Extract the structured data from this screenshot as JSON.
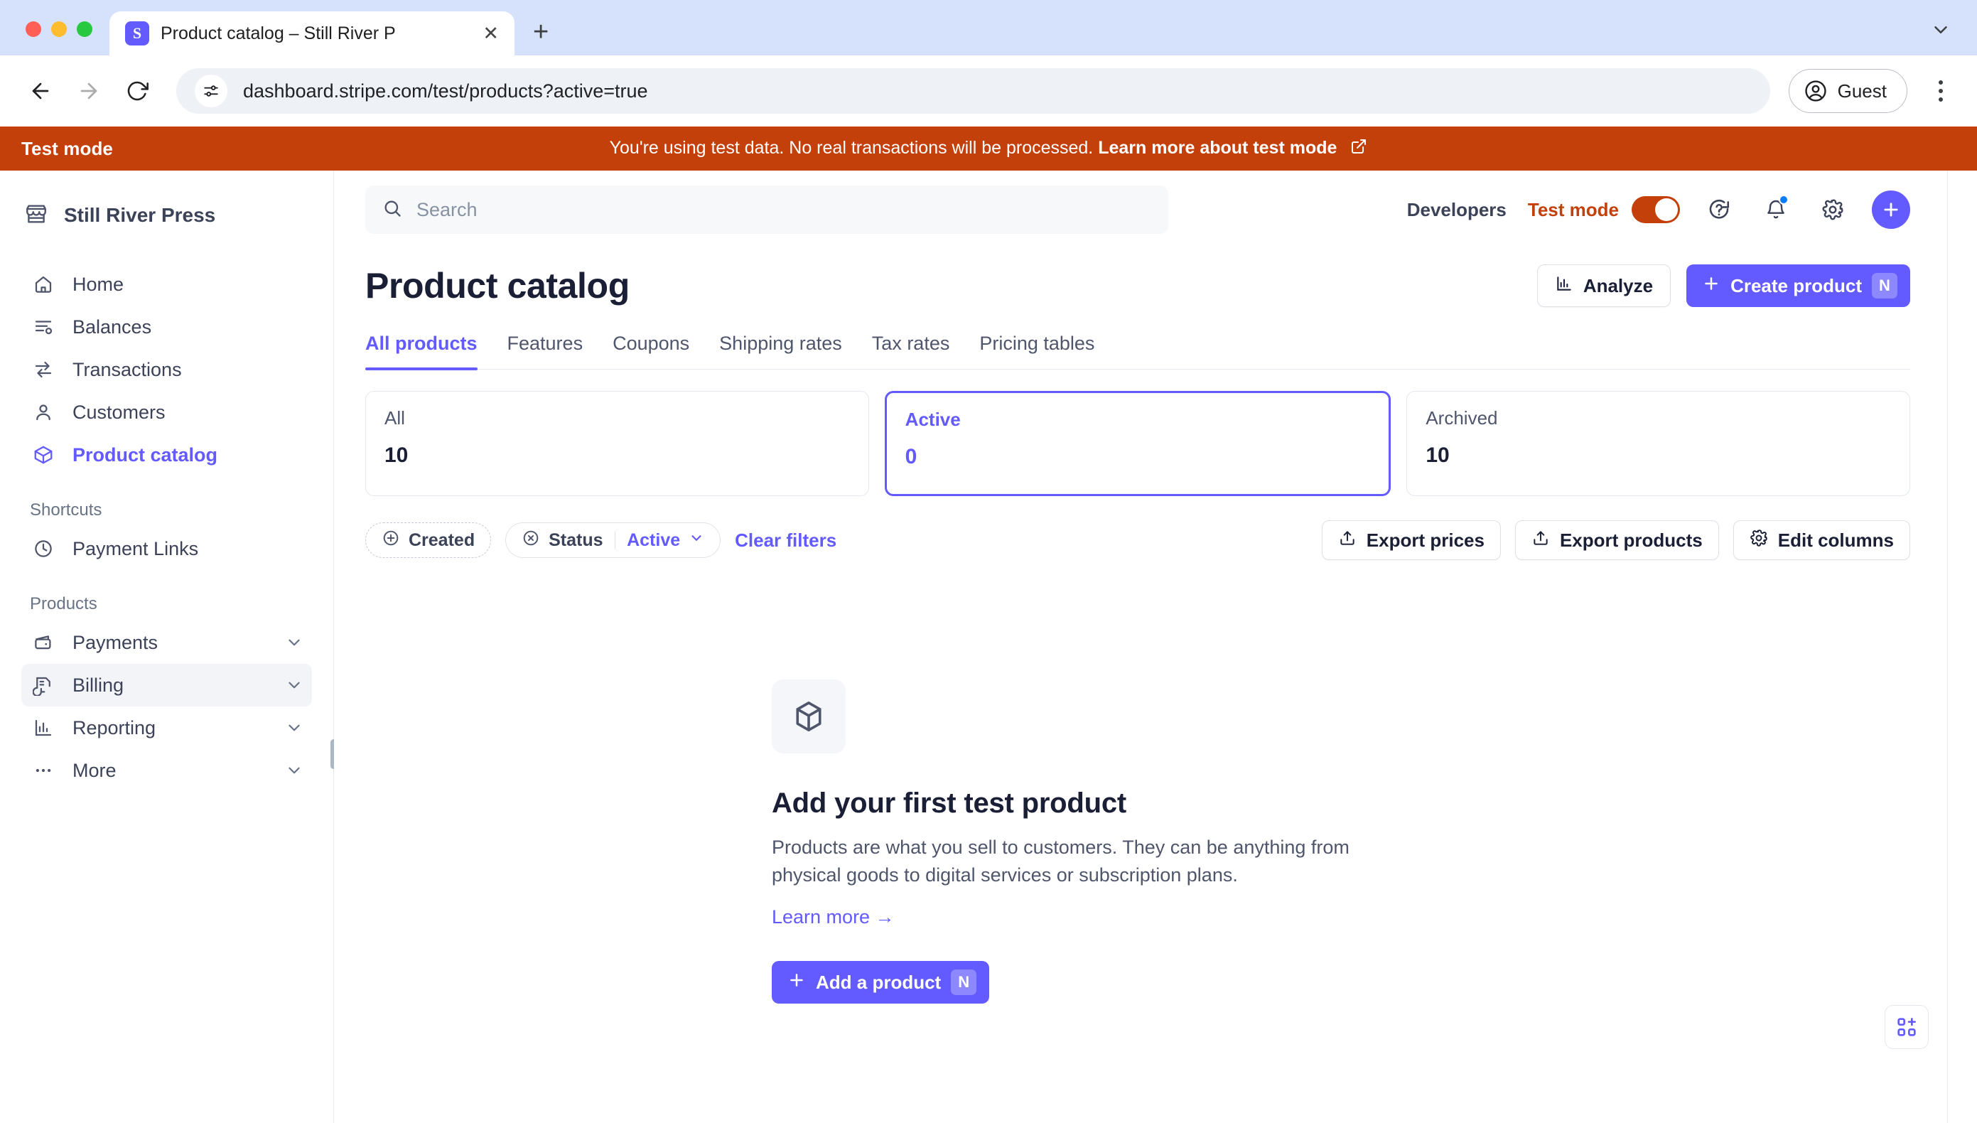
{
  "browser": {
    "tab_title": "Product catalog – Still River P",
    "favicon_letter": "S",
    "url": "dashboard.stripe.com/test/products?active=true",
    "profile_label": "Guest",
    "new_tab_label": "+",
    "close_tab_label": "✕"
  },
  "test_banner": {
    "left_label": "Test mode",
    "message": "You're using test data. No real transactions will be processed.",
    "link": "Learn more about test mode"
  },
  "sidebar": {
    "brand": "Still River Press",
    "items": [
      {
        "label": "Home",
        "icon": "home-icon",
        "active": false
      },
      {
        "label": "Balances",
        "icon": "balances-icon",
        "active": false
      },
      {
        "label": "Transactions",
        "icon": "transactions-icon",
        "active": false
      },
      {
        "label": "Customers",
        "icon": "customers-icon",
        "active": false
      },
      {
        "label": "Product catalog",
        "icon": "product-catalog-icon",
        "active": true
      }
    ],
    "shortcuts_label": "Shortcuts",
    "shortcuts": [
      {
        "label": "Payment Links",
        "icon": "clock-icon"
      }
    ],
    "products_label": "Products",
    "products": [
      {
        "label": "Payments",
        "icon": "wallet-icon",
        "hover": false
      },
      {
        "label": "Billing",
        "icon": "billing-icon",
        "hover": true
      },
      {
        "label": "Reporting",
        "icon": "reporting-icon",
        "hover": false
      },
      {
        "label": "More",
        "icon": "more-icon",
        "hover": false
      }
    ]
  },
  "topbar": {
    "search_placeholder": "Search",
    "developers_label": "Developers",
    "test_mode_label": "Test mode",
    "test_mode_on": true
  },
  "page": {
    "title": "Product catalog",
    "analyze_label": "Analyze",
    "create_label": "Create product",
    "create_shortcut": "N"
  },
  "tabs": [
    {
      "label": "All products",
      "active": true
    },
    {
      "label": "Features",
      "active": false
    },
    {
      "label": "Coupons",
      "active": false
    },
    {
      "label": "Shipping rates",
      "active": false
    },
    {
      "label": "Tax rates",
      "active": false
    },
    {
      "label": "Pricing tables",
      "active": false
    }
  ],
  "stat_cards": [
    {
      "label": "All",
      "value": "10",
      "selected": false
    },
    {
      "label": "Active",
      "value": "0",
      "selected": true
    },
    {
      "label": "Archived",
      "value": "10",
      "selected": false
    }
  ],
  "filters": {
    "created_label": "Created",
    "status_label": "Status",
    "status_value": "Active",
    "clear_label": "Clear filters",
    "export_prices_label": "Export prices",
    "export_products_label": "Export products",
    "edit_columns_label": "Edit columns"
  },
  "empty_state": {
    "title": "Add your first test product",
    "description": "Products are what you sell to customers. They can be anything from physical goods to digital services or subscription plans.",
    "link_label": "Learn more →",
    "button_label": "Add a product",
    "button_shortcut": "N"
  },
  "colors": {
    "brand_purple": "#635bff",
    "test_orange": "#c4400a",
    "text_dark": "#1a1f36",
    "text_muted": "#4f566b",
    "border": "#e3e8ee"
  }
}
